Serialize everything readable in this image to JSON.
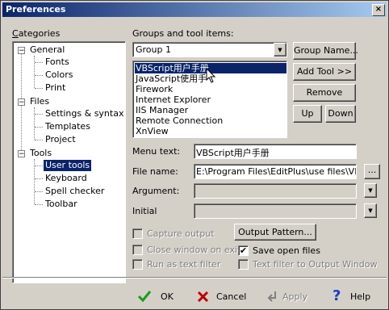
{
  "window": {
    "title": "Preferences",
    "close_glyph": "×"
  },
  "categories": {
    "label": "Categories",
    "tree": [
      {
        "label": "General"
      },
      {
        "label": "Fonts"
      },
      {
        "label": "Colors"
      },
      {
        "label": "Print"
      },
      {
        "label": "Files"
      },
      {
        "label": "Settings & syntax"
      },
      {
        "label": "Templates"
      },
      {
        "label": "Project"
      },
      {
        "label": "Tools"
      },
      {
        "label": "User tools"
      },
      {
        "label": "Keyboard"
      },
      {
        "label": "Spell checker"
      },
      {
        "label": "Toolbar"
      }
    ],
    "expander_glyph": "−"
  },
  "groups": {
    "label": "Groups and tool items:",
    "selected_group": "Group 1",
    "items": [
      "VBScript用户手册",
      "JavaScript使用手",
      "Firework",
      "Internet Explorer",
      "IIS Manager",
      "Remote Connection",
      "XnView"
    ],
    "buttons": {
      "group_name": "Group Name...",
      "add_tool": "Add Tool >>",
      "remove": "Remove",
      "up": "Up",
      "down": "Down"
    }
  },
  "fields": {
    "menu_text_label": "Menu text:",
    "menu_text_value": "VBScript用户手册",
    "file_name_label": "File name:",
    "file_name_value": "E:\\Program Files\\EditPlus\\use files\\VBScrip",
    "browse": "...",
    "argument_label": "Argument:",
    "argument_value": "",
    "initial_label": "Initial",
    "initial_value": ""
  },
  "options": {
    "capture_output": "Capture output",
    "close_window": "Close window on exit",
    "run_as_filter": "Run as text filter",
    "output_pattern": "Output Pattern...",
    "save_open_files": "Save open files",
    "text_filter": "Text filter to Output Window",
    "check_glyph": "✔"
  },
  "footer": {
    "ok": "OK",
    "cancel": "Cancel",
    "apply": "Apply",
    "help": "Help"
  },
  "colors": {
    "title_start": "#0a246a",
    "title_end": "#a6caf0",
    "selection": "#0a246a",
    "face": "#d4d0c8"
  }
}
